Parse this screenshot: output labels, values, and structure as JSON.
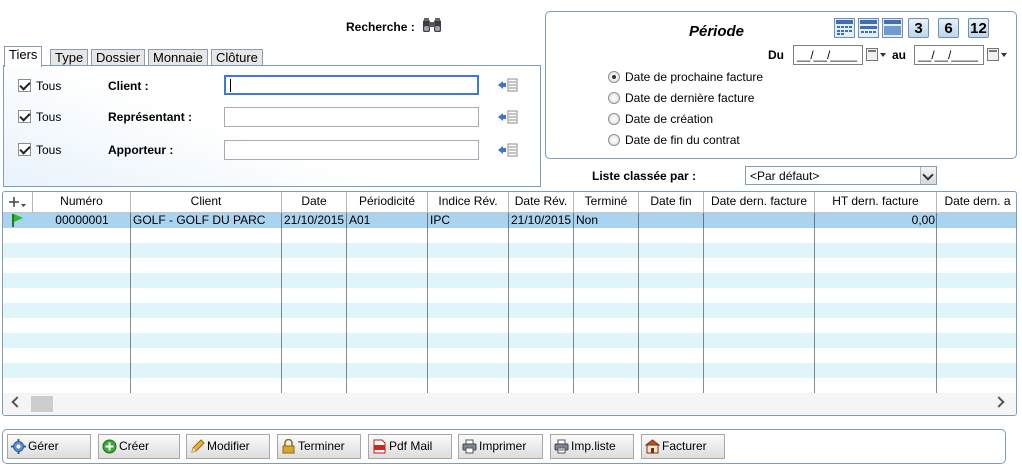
{
  "search": {
    "label": "Recherche :"
  },
  "tabs": [
    {
      "label": "Tiers",
      "active": true
    },
    {
      "label": "Type"
    },
    {
      "label": "Dossier"
    },
    {
      "label": "Monnaie"
    },
    {
      "label": "Clôture"
    }
  ],
  "tiers": {
    "rows": [
      {
        "check_label": "Tous",
        "checked": true,
        "field_label": "Client :",
        "value": ""
      },
      {
        "check_label": "Tous",
        "checked": true,
        "field_label": "Représentant :",
        "value": ""
      },
      {
        "check_label": "Tous",
        "checked": true,
        "field_label": "Apporteur :",
        "value": ""
      }
    ]
  },
  "periode": {
    "title": "Période",
    "quick_buttons": [
      "3",
      "6",
      "12"
    ],
    "du_label": "Du",
    "au_label": "au",
    "du_value": "__/__/____",
    "au_value": "__/__/____",
    "options": [
      {
        "label": "Date de prochaine facture",
        "selected": true
      },
      {
        "label": "Date de dernière facture",
        "selected": false
      },
      {
        "label": "Date de création",
        "selected": false
      },
      {
        "label": "Date de fin du contrat",
        "selected": false
      }
    ]
  },
  "sort": {
    "label": "Liste classée par :",
    "value": "<Par défaut>"
  },
  "grid": {
    "columns": [
      "Numéro",
      "Client",
      "Date",
      "Périodicité",
      "Indice Rév.",
      "Date Rév.",
      "Terminé",
      "Date fin",
      "Date dern. facture",
      "HT dern. facture",
      "Date dern. a"
    ],
    "rows": [
      {
        "numero": "00000001",
        "client": "GOLF - GOLF DU PARC",
        "date": "21/10/2015",
        "periodicite": "A01",
        "indice": "IPC",
        "date_rev": "21/10/2015",
        "termine": "Non",
        "date_fin": "",
        "date_dern": "",
        "ht_dern": "0,00",
        "date_dern_a": ""
      }
    ]
  },
  "toolbar": {
    "gerer": "Gérer",
    "creer": "Créer",
    "modifier": "Modifier",
    "terminer": "Terminer",
    "pdf_mail": "Pdf Mail",
    "imprimer": "Imprimer",
    "imp_liste": "Imp.liste",
    "facturer": "Facturer"
  },
  "colors": {
    "selection": "#a9d3ee",
    "alt_row": "#dff5fa",
    "panel_border": "#7f9db9"
  }
}
